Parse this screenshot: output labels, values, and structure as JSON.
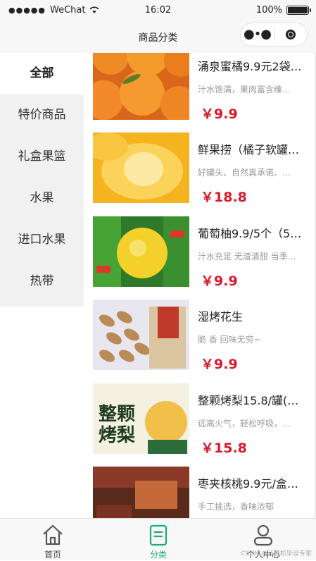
{
  "status_bar": {
    "carrier": "WeChat",
    "time": "16:02",
    "battery": "100%"
  },
  "navbar": {
    "title": "商品分类",
    "more_icon": "more-dots-icon",
    "close_icon": "target-icon"
  },
  "sidebar": {
    "items": [
      {
        "label": "全部",
        "active": true
      },
      {
        "label": "特价商品",
        "active": false
      },
      {
        "label": "礼盒果篮",
        "active": false
      },
      {
        "label": "水果",
        "active": false
      },
      {
        "label": "进口水果",
        "active": false
      },
      {
        "label": "热带",
        "active": false
      }
    ]
  },
  "products": [
    {
      "name": "涌泉蜜橘9.9元2袋…",
      "desc": "汁水饱满，果肉富含维…",
      "price": "￥9.9",
      "image": "oranges"
    },
    {
      "name": "鲜果捞（橘子软罐…",
      "desc": "好罐头、自然真承诺、…",
      "price": "￥18.8",
      "image": "peach-can"
    },
    {
      "name": "葡萄柚9.9/5个（5…",
      "desc": "汁水充足 无渣清甜 当季…",
      "price": "￥9.9",
      "image": "grapefruit"
    },
    {
      "name": "湿烤花生",
      "desc": "脆 香 回味无穷~",
      "price": "￥9.9",
      "image": "peanuts"
    },
    {
      "name": "整颗烤梨15.8/罐(…",
      "desc": "远离火气，轻松呼吸，…",
      "price": "￥15.8",
      "image": "roast-pear",
      "image_text": "整颗烤梨"
    },
    {
      "name": "枣夹核桃9.9元/盒…",
      "desc": "手工挑选，香味浓郁",
      "price": "",
      "image": "dates"
    }
  ],
  "tabbar": {
    "items": [
      {
        "label": "首页",
        "icon": "home-icon",
        "active": false
      },
      {
        "label": "分类",
        "icon": "category-icon",
        "active": true
      },
      {
        "label": "个人中心",
        "icon": "user-icon",
        "active": false
      }
    ]
  },
  "watermark": "CSDN @计算机毕设专家",
  "colors": {
    "price": "#d8182d",
    "active_tab": "#1aab77",
    "sidebar_bg": "#f1f1f1"
  }
}
